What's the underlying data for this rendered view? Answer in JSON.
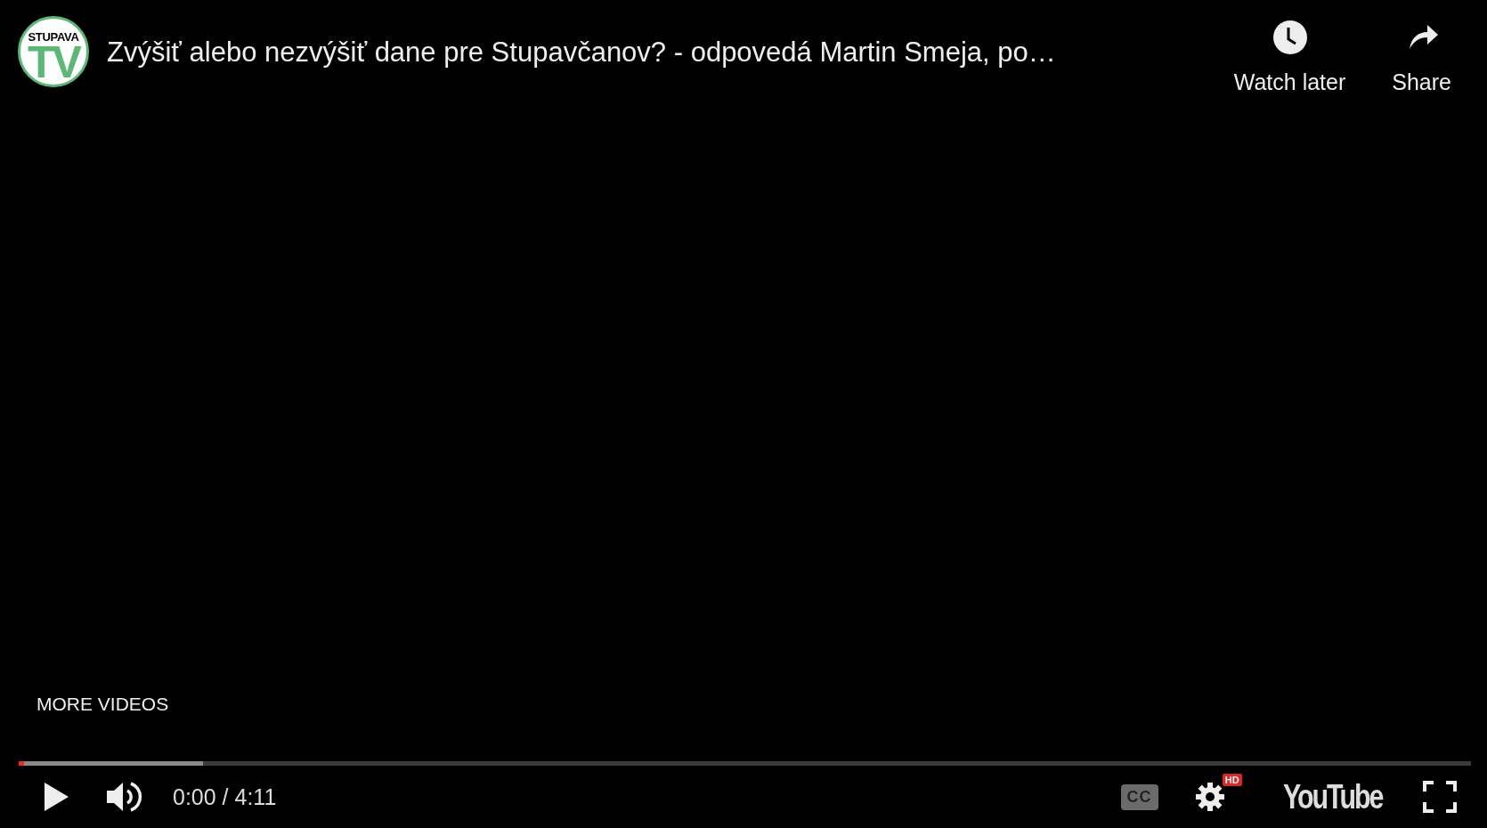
{
  "channel_logo": {
    "top_text": "STUPAVA",
    "letters": "TV"
  },
  "title": "Zvýšiť alebo nezvýšiť dane pre Stupavčanov? - odpovedá Martin Smeja, po…",
  "actions": [
    {
      "kind": "watch_later",
      "label": "Watch later"
    },
    {
      "kind": "share",
      "label": "Share"
    }
  ],
  "more_videos": "MORE VIDEOS",
  "progress": {
    "level": 0
  },
  "buffered": {
    "level": 0.127
  },
  "controls": {
    "playing": false,
    "muted": false,
    "time": "0:00 / 4:11",
    "captions": "CC",
    "quality_badge": "HD",
    "brand": "YouTube"
  }
}
